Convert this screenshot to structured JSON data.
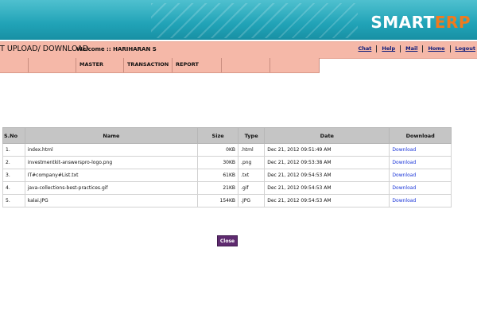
{
  "header": {
    "logo_smart": "SMART",
    "logo_erp": "ERP"
  },
  "titlebar": {
    "title": "T UPLOAD/ DOWNLOAD",
    "welcome": "Welcome :: HARIHARAN S",
    "links": [
      "Chat",
      "Help",
      "Mail",
      "Home",
      "Logout"
    ]
  },
  "menu": {
    "items": [
      "",
      "",
      "MASTER",
      "TRANSACTION",
      "REPORT",
      "",
      ""
    ]
  },
  "table": {
    "headers": [
      "S.No",
      "Name",
      "Size",
      "Type",
      "Date",
      "Download"
    ],
    "rows": [
      {
        "sno": "1.",
        "name": "index.html",
        "size": "0KB",
        "type": ".html",
        "date": "Dec 21, 2012 09:51:49 AM",
        "download": "Download"
      },
      {
        "sno": "2.",
        "name": "investmentkit-answerspro-logo.png",
        "size": "30KB",
        "type": ".png",
        "date": "Dec 21, 2012 09:53:38 AM",
        "download": "Download"
      },
      {
        "sno": "3.",
        "name": "IT#company#List.txt",
        "size": "61KB",
        "type": ".txt",
        "date": "Dec 21, 2012 09:54:53 AM",
        "download": "Download"
      },
      {
        "sno": "4.",
        "name": "java-collections-best-practices.gif",
        "size": "21KB",
        "type": ".gif",
        "date": "Dec 21, 2012 09:54:53 AM",
        "download": "Download"
      },
      {
        "sno": "5.",
        "name": "kalai.JPG",
        "size": "154KB",
        "type": ".JPG",
        "date": "Dec 21, 2012 09:54:53 AM",
        "download": "Download"
      }
    ]
  },
  "close_label": "Close"
}
